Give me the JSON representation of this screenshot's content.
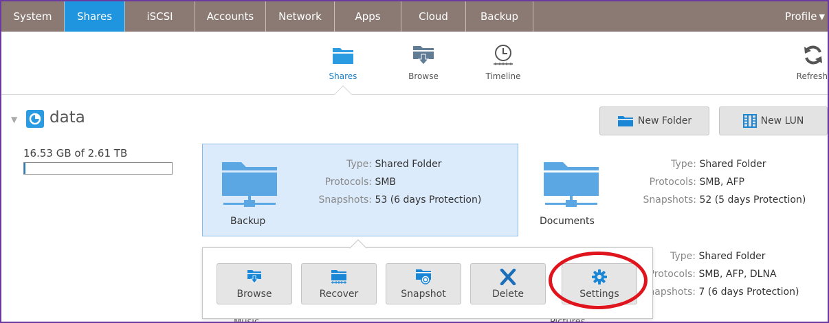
{
  "nav": {
    "tabs": [
      {
        "label": "System",
        "active": false
      },
      {
        "label": "Shares",
        "active": true
      },
      {
        "label": "iSCSI",
        "active": false
      },
      {
        "label": "Accounts",
        "active": false
      },
      {
        "label": "Network",
        "active": false
      },
      {
        "label": "Apps",
        "active": false
      },
      {
        "label": "Cloud",
        "active": false
      },
      {
        "label": "Backup",
        "active": false
      }
    ],
    "profile": "Profile"
  },
  "subnav": {
    "shares": "Shares",
    "browse": "Browse",
    "timeline": "Timeline",
    "refresh": "Refresh"
  },
  "volume": {
    "name": "data",
    "usage_text": "16.53 GB of 2.61 TB",
    "usage_fraction": 0.006
  },
  "toolbar": {
    "new_folder": "New Folder",
    "new_lun": "New LUN"
  },
  "labels": {
    "type": "Type:",
    "protocols": "Protocols:",
    "snapshots": "Snapshots:"
  },
  "shares": [
    {
      "name": "Backup",
      "type": "Shared Folder",
      "protocols": "SMB",
      "snapshots": "53 (6 days Protection)"
    },
    {
      "name": "Documents",
      "type": "Shared Folder",
      "protocols": "SMB, AFP",
      "snapshots": "52 (5 days Protection)"
    },
    {
      "name": "Music",
      "type": "",
      "protocols": "",
      "snapshots": ""
    },
    {
      "name": "Pictures",
      "type": "Shared Folder",
      "protocols": "SMB, AFP, DLNA",
      "snapshots": "7 (6 days Protection)"
    }
  ],
  "actions": {
    "browse": "Browse",
    "recover": "Recover",
    "snapshot": "Snapshot",
    "delete": "Delete",
    "settings": "Settings"
  },
  "colors": {
    "nav_bg": "#8a7a73",
    "accent": "#1e95de",
    "selected_card": "#dcebfb",
    "highlight_ring": "#e0141c"
  }
}
